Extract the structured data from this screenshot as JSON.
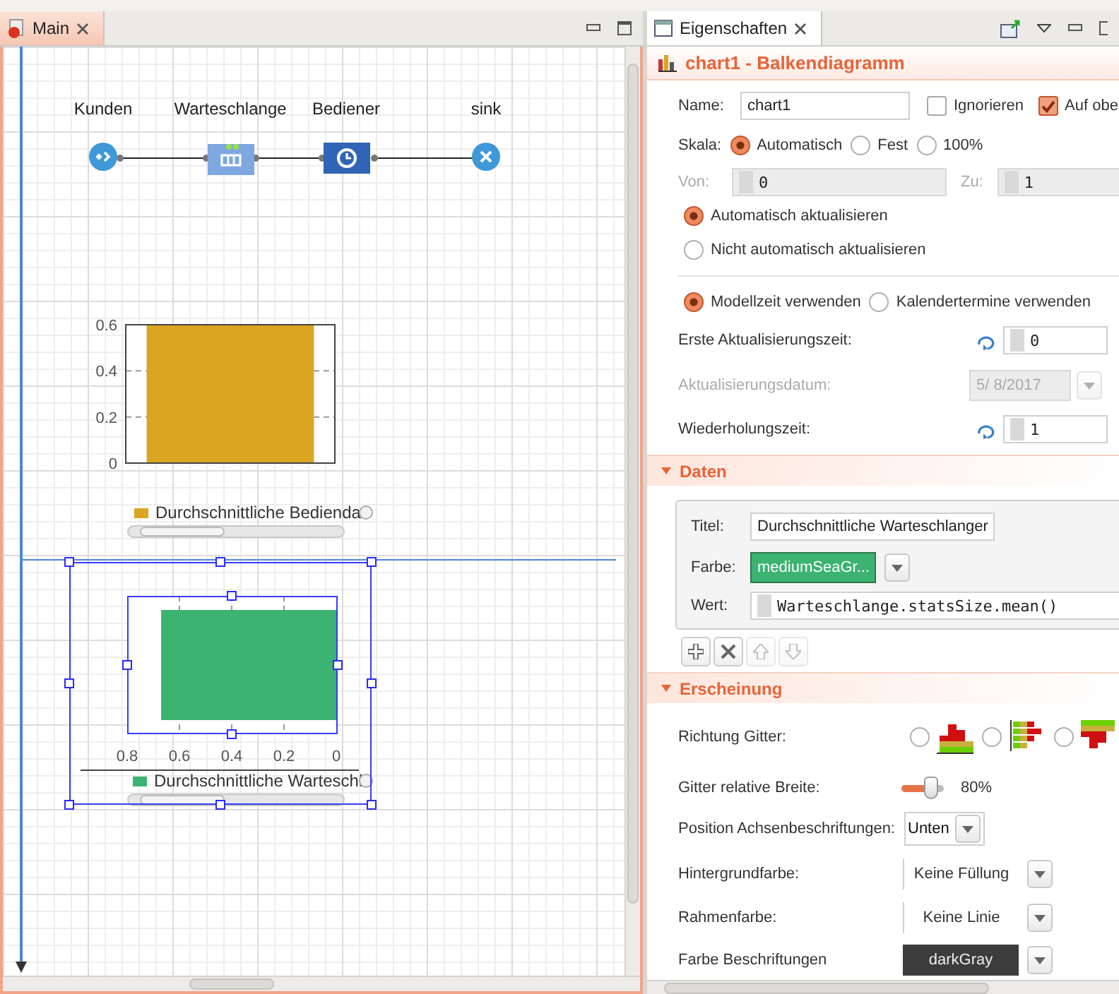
{
  "editor": {
    "tab": {
      "label": "Main",
      "selected": true
    },
    "nodes": [
      {
        "label": "Kunden",
        "kind": "source"
      },
      {
        "label": "Warteschlange",
        "kind": "queue"
      },
      {
        "label": "Bediener",
        "kind": "delay"
      },
      {
        "label": "sink",
        "kind": "sink"
      }
    ],
    "charts": [
      {
        "selected": false,
        "chart_data": {
          "type": "bar",
          "orientation": "vertical",
          "grid": true,
          "ylim": [
            0,
            0.6
          ],
          "yticks": [
            0,
            0.2,
            0.4,
            0.6
          ],
          "series": [
            {
              "name": "Durchschnittliche Bedienda",
              "color": "#daa520",
              "values": [
                0.6
              ]
            }
          ]
        }
      },
      {
        "selected": true,
        "chart_data": {
          "type": "bar",
          "orientation": "horizontal",
          "grid": true,
          "xlim": [
            0.8,
            0
          ],
          "xticks": [
            0.8,
            0.6,
            0.4,
            0.2,
            0
          ],
          "series": [
            {
              "name": "Durchschnittliche Warteschl",
              "color": "#3cb371",
              "values": [
                0.67
              ]
            }
          ]
        }
      }
    ]
  },
  "properties": {
    "tab": {
      "label": "Eigenschaften",
      "selected": true
    },
    "title": "chart1 - Balkendiagramm",
    "name": {
      "label": "Name:",
      "value": "chart1"
    },
    "options": [
      {
        "label": "Ignorieren",
        "checked": false
      },
      {
        "label": "Auf obe",
        "checked": true
      }
    ],
    "scale": {
      "label": "Skala:",
      "options": [
        {
          "label": "Automatisch",
          "selected": true
        },
        {
          "label": "Fest",
          "selected": false
        },
        {
          "label": "100%",
          "selected": false
        }
      ]
    },
    "range": {
      "disabled": true,
      "from_label": "Von:",
      "from": "0",
      "to_label": "Zu:",
      "to": "1"
    },
    "update_mode": [
      {
        "label": "Automatisch aktualisieren",
        "selected": true
      },
      {
        "label": "Nicht automatisch aktualisieren",
        "selected": false
      }
    ],
    "time_mode": [
      {
        "label": "Modellzeit verwenden",
        "selected": true
      },
      {
        "label": "Kalendertermine verwenden",
        "selected": false
      }
    ],
    "first_update": {
      "label": "Erste Aktualisierungszeit:",
      "value": "0"
    },
    "update_date": {
      "label": "Aktualisierungsdatum:",
      "value": "5/ 8/2017",
      "disabled": true
    },
    "recurrence": {
      "label": "Wiederholungszeit:",
      "value": "1"
    },
    "data_section": {
      "title": "Daten",
      "expanded": true,
      "caption": {
        "label": "Titel:",
        "value": "Durchschnittliche Warteschlanger"
      },
      "color": {
        "label": "Farbe:",
        "value": "mediumSeaGr...",
        "color": "#3cb371"
      },
      "value": {
        "label": "Wert:",
        "value": "Warteschlange.statsSize.mean()"
      },
      "actions": [
        {
          "kind": "add",
          "disabled": false
        },
        {
          "kind": "remove",
          "disabled": false
        },
        {
          "kind": "up",
          "disabled": true
        },
        {
          "kind": "down",
          "disabled": true
        }
      ]
    },
    "appearance_section": {
      "title": "Erscheinung",
      "expanded": true,
      "direction": {
        "label": "Richtung Gitter:",
        "options": [
          {
            "kind": "vertical",
            "selected": false
          },
          {
            "kind": "horizontal",
            "selected": false
          },
          {
            "kind": "downward",
            "selected": false
          }
        ]
      },
      "bar_width": {
        "label": "Gitter relative Breite:",
        "level": 0.8,
        "reading": "80%"
      },
      "label_position": {
        "label": "Position Achsenbeschriftungen:",
        "value": "Unten"
      },
      "background": {
        "label": "Hintergrundfarbe:",
        "value": "Keine Füllung"
      },
      "border": {
        "label": "Rahmenfarbe:",
        "value": "Keine Linie"
      },
      "label_color": {
        "label": "Farbe Beschriftungen",
        "value": "darkGray",
        "color": "#3c3c3c"
      }
    }
  }
}
